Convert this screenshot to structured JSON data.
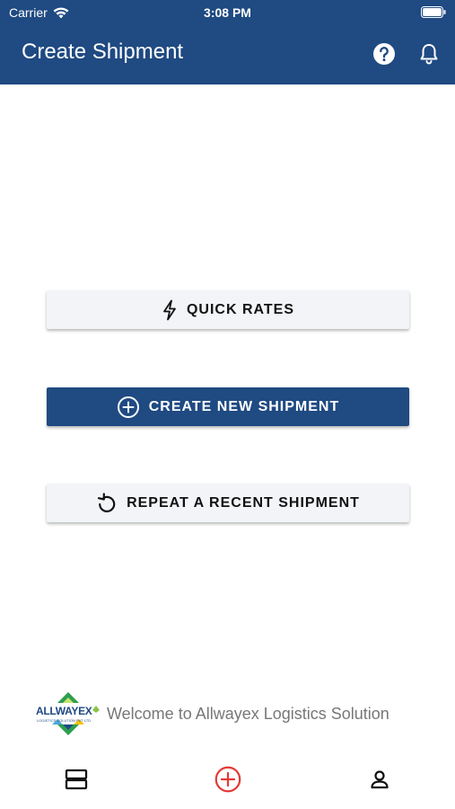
{
  "status_bar": {
    "carrier": "Carrier",
    "time": "3:08 PM"
  },
  "app_bar": {
    "title": "Create Shipment",
    "help_icon": "help-circle-icon",
    "bell_icon": "bell-icon"
  },
  "actions": {
    "quick_rates": "QUICK RATES",
    "create_new": "CREATE NEW SHIPMENT",
    "repeat_recent": "REPEAT A RECENT SHIPMENT"
  },
  "footer": {
    "logo_text": "ALLWAYEX",
    "logo_subtext": "LOGISTICS SOLUTION PVT LTD",
    "welcome": "Welcome to Allwayex Logistics Solution"
  },
  "tabs": [
    "list-icon",
    "add-circle-icon",
    "profile-icon"
  ],
  "colors": {
    "primary": "#1f4a82",
    "accent_red": "#e53935",
    "button_light": "#f2f4f7"
  }
}
